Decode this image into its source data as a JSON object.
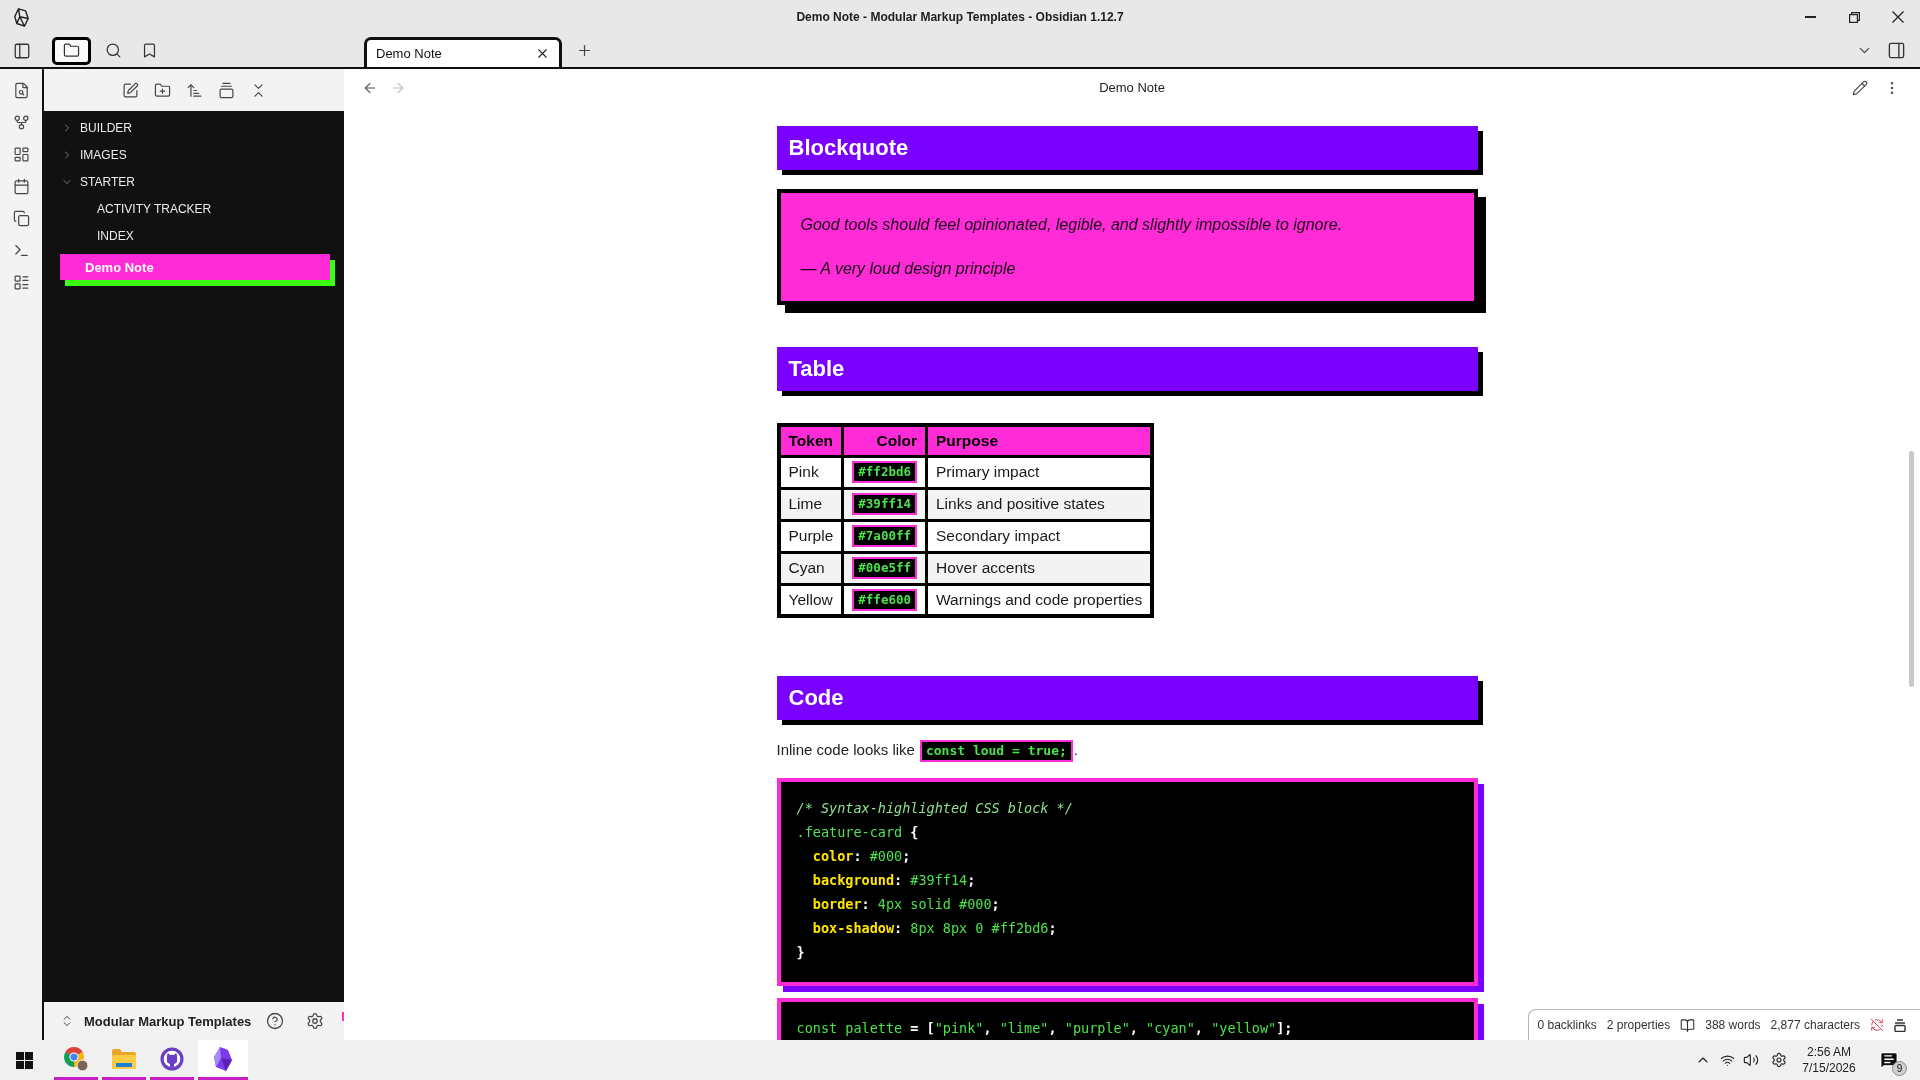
{
  "window": {
    "title": "Demo Note - Modular Markup Templates - Obsidian 1.12.7"
  },
  "left_toolbar": [
    {
      "kind": "files",
      "selected": true
    },
    {
      "kind": "search",
      "selected": false
    },
    {
      "kind": "bookmarks",
      "selected": false
    }
  ],
  "tabs": [
    {
      "label": "Demo Note",
      "selected": true
    }
  ],
  "file_tree": [
    {
      "kind": "folder",
      "label": "BUILDER",
      "expanded": false,
      "selected": false
    },
    {
      "kind": "folder",
      "label": "IMAGES",
      "expanded": false,
      "selected": false
    },
    {
      "kind": "folder",
      "label": "STARTER",
      "expanded": true,
      "selected": false,
      "children": [
        {
          "kind": "file",
          "label": "ACTIVITY TRACKER",
          "selected": false
        },
        {
          "kind": "file",
          "label": "INDEX",
          "selected": false
        }
      ]
    },
    {
      "kind": "file",
      "label": "Demo Note",
      "selected": true
    }
  ],
  "vault": {
    "name": "Modular Markup Templates"
  },
  "view_header": {
    "title": "Demo Note",
    "back": {
      "disabled": false
    },
    "forward": {
      "disabled": true
    }
  },
  "note": [
    {
      "kind": "heading",
      "text": "Blockquote"
    },
    {
      "kind": "blockquote",
      "lines": [
        "Good tools should feel opinionated, legible, and slightly impossible to ignore.",
        "— A very loud design principle"
      ]
    },
    {
      "kind": "heading",
      "text": "Table"
    },
    {
      "kind": "table",
      "columns": [
        {
          "label": "Token",
          "kind": "text"
        },
        {
          "label": "Color",
          "kind": "code"
        },
        {
          "label": "Purpose",
          "kind": "text"
        }
      ],
      "rows": [
        [
          "Pink",
          "#ff2bd6",
          "Primary impact"
        ],
        [
          "Lime",
          "#39ff14",
          "Links and positive states"
        ],
        [
          "Purple",
          "#7a00ff",
          "Secondary impact"
        ],
        [
          "Cyan",
          "#00e5ff",
          "Hover accents"
        ],
        [
          "Yellow",
          "#ffe600",
          "Warnings and code properties"
        ]
      ]
    },
    {
      "kind": "heading",
      "text": "Code"
    },
    {
      "kind": "paragraph",
      "parts": [
        {
          "kind": "text",
          "text": "Inline code looks like"
        },
        {
          "kind": "code",
          "text": "const loud = true;"
        },
        {
          "kind": "text",
          "text": "."
        }
      ]
    },
    {
      "kind": "code",
      "lines": [
        [
          {
            "kind": "comment",
            "text": "/* Syntax-highlighted CSS block */"
          }
        ],
        [
          {
            "kind": "selector",
            "text": ".feature-card"
          },
          {
            "kind": "plain",
            "text": " {"
          }
        ],
        [
          {
            "kind": "property",
            "text": "  color"
          },
          {
            "kind": "plain",
            "text": ": "
          },
          {
            "kind": "value",
            "text": "#000"
          },
          {
            "kind": "plain",
            "text": ";"
          }
        ],
        [
          {
            "kind": "property",
            "text": "  background"
          },
          {
            "kind": "plain",
            "text": ": "
          },
          {
            "kind": "value",
            "text": "#39ff14"
          },
          {
            "kind": "plain",
            "text": ";"
          }
        ],
        [
          {
            "kind": "property",
            "text": "  border"
          },
          {
            "kind": "plain",
            "text": ": "
          },
          {
            "kind": "value",
            "text": "4px solid #000"
          },
          {
            "kind": "plain",
            "text": ";"
          }
        ],
        [
          {
            "kind": "property",
            "text": "  box-shadow"
          },
          {
            "kind": "plain",
            "text": ": "
          },
          {
            "kind": "value",
            "text": "8px 8px 0 #ff2bd6"
          },
          {
            "kind": "plain",
            "text": ";"
          }
        ],
        [
          {
            "kind": "plain",
            "text": "}"
          }
        ]
      ]
    },
    {
      "kind": "code",
      "lines": [
        [
          {
            "kind": "keyword",
            "text": "const palette"
          },
          {
            "kind": "plain",
            "text": " = ["
          },
          {
            "kind": "string",
            "text": "\"pink\""
          },
          {
            "kind": "plain",
            "text": ", "
          },
          {
            "kind": "string",
            "text": "\"lime\""
          },
          {
            "kind": "plain",
            "text": ", "
          },
          {
            "kind": "string",
            "text": "\"purple\""
          },
          {
            "kind": "plain",
            "text": ", "
          },
          {
            "kind": "string",
            "text": "\"cyan\""
          },
          {
            "kind": "plain",
            "text": ", "
          },
          {
            "kind": "string",
            "text": "\"yellow\""
          },
          {
            "kind": "plain",
            "text": "];"
          }
        ]
      ]
    }
  ],
  "status_bar": {
    "backlinks": "0 backlinks",
    "properties": "2 properties",
    "words": "388 words",
    "characters": "2,877 characters"
  },
  "taskbar": {
    "apps": [
      {
        "kind": "browser",
        "running": true,
        "selected": false
      },
      {
        "kind": "file_manager",
        "running": true,
        "selected": false
      },
      {
        "kind": "git_client",
        "running": true,
        "selected": false
      },
      {
        "kind": "notes",
        "running": true,
        "selected": true
      }
    ],
    "clock": {
      "time": "2:56 AM",
      "date": "7/15/2026"
    },
    "notifications": "9"
  }
}
